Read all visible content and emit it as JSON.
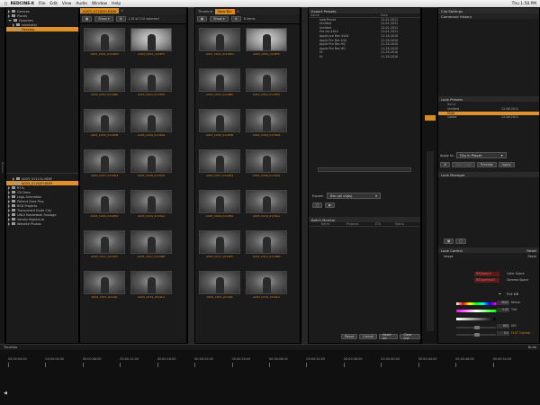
{
  "menubar": {
    "app": "REDCINE-X",
    "items": [
      "File",
      "Edit",
      "View",
      "Audio",
      "Window",
      "Help"
    ],
    "clock": "Thu 1:58 PM"
  },
  "browser": {
    "tree_top": [
      {
        "label": "Devices",
        "selected": false,
        "expanded": false
      },
      {
        "label": "Places",
        "selected": false,
        "expanded": false
      },
      {
        "label": "Favorites",
        "selected": false,
        "expanded": true
      },
      {
        "label": "robohatty",
        "selected": false,
        "expanded": false
      },
      {
        "label": "Desktop",
        "selected": true,
        "expanded": false
      }
    ],
    "tree_bottom": [
      {
        "label": "A003_0111OL.RDM",
        "selected": false
      },
      {
        "label": "A003_0116ZH.RDM",
        "selected": true
      },
      {
        "label": "R??s",
        "selected": false
      },
      {
        "label": "CD Drea",
        "selected": false
      },
      {
        "label": "Lego Animation",
        "selected": false
      },
      {
        "label": "Patient Zero Plus",
        "selected": false
      },
      {
        "label": "RED Projects",
        "selected": false
      },
      {
        "label": "Transcoded Dude City",
        "selected": false
      },
      {
        "label": "UNLV Basketball Footage",
        "selected": false
      },
      {
        "label": "Varsity Nightclub",
        "selected": false
      },
      {
        "label": "Website Photos",
        "selected": false
      }
    ]
  },
  "clips_panel": {
    "tab": "A003_0116ZH.RDM",
    "view_label": "Show",
    "count_text": "110 of 110 selected",
    "clips": [
      "A003_C001_0119W0",
      "A003_C002_0119F6",
      "A003_C003_0119BS",
      "A003_C004_0119HS",
      "A003_C005_0119KM",
      "A003_C006_0119G8",
      "A003_C007_0119R4",
      "A003_C008_0119CD",
      "A003_C009_0119M1",
      "A003_C010_0119AA",
      "A003_C011_0119P3",
      "A003_C012_0119NN",
      "A003_C013_0119JS",
      "A003_C014_0119LU"
    ]
  },
  "bin_panel": {
    "tab_timeline": "Timeline",
    "tab_bin": "New Bin",
    "view_label": "Show",
    "count_text": "8 items",
    "clips": [
      "A003_C001_0119W0",
      "A003_C002_0119F6",
      "A003_C003_0119BS",
      "A003_C004_0119HS",
      "A003_C005_0119KM",
      "A003_C006_0119G8",
      "A003_C007_0119R4",
      "A003_C008_0119CD",
      "A003_C009_0119M1",
      "A003_C010_0119AA",
      "A003_C011_0119P3",
      "A003_C012_0119NN",
      "A003_C013_0119JS",
      "A003_C014_0119LU"
    ]
  },
  "export": {
    "title": "Export Presets",
    "col_name": "Name",
    "col_date": "Date",
    "presets": [
      {
        "name": "InterPreset",
        "date": "12-01-2011"
      },
      {
        "name": "Untitled",
        "date": "12-01-2011"
      },
      {
        "name": "Untitled",
        "date": "12-01-2011"
      },
      {
        "name": "Pro res 4444",
        "date": "12-01-2011"
      },
      {
        "name": "Apple pro Res 4444",
        "date": "11-28-2010"
      },
      {
        "name": "Apple Pro Res 444",
        "date": "11-28-2010"
      },
      {
        "name": "Apple Pro Res HQ",
        "date": "11-28-2010"
      },
      {
        "name": "Apple Pro Res HQ",
        "date": "11-28-2010"
      },
      {
        "name": "Hi",
        "date": "11-28-2010"
      },
      {
        "name": "Hi",
        "date": "11-28-2010"
      }
    ],
    "export_label": "Export:",
    "export_value": "Bin (all clips)",
    "batch_title": "Batch Monitor",
    "batch_cols": [
      "Name",
      "Progress",
      "ETA",
      "Status"
    ],
    "batch_buttons": [
      "Pause",
      "Cancel",
      "Abort All",
      "Clear List"
    ]
  },
  "clip_settings": {
    "title": "Clip Settings",
    "history_title": "Command History"
  },
  "look_presets": {
    "title": "Look Presets",
    "col_name": "Name",
    "items": [
      {
        "name": "Untitled",
        "date": "12-06-2011",
        "selected": false
      },
      {
        "name": "Mute",
        "date": "",
        "selected": true
      },
      {
        "name": "Copier",
        "date": "12-06-2011",
        "selected": false
      }
    ],
    "apply_label": "Apply to:",
    "apply_value": "Clip in Player",
    "preview_label": "Preview",
    "apply_btn": "Apply",
    "save_label": "Save Look"
  },
  "look_manager": {
    "title": "Look Manager"
  },
  "look_control": {
    "title": "Look Control",
    "zoom_label": "Reset",
    "image_label": "Image",
    "image_reset": "Reset",
    "color_space_value": "REDcolor3",
    "color_space_label": "Color Space",
    "gamma_value": "REDgamma3",
    "gamma_label": "Gamma Space",
    "pick_wb": "Pick WB",
    "kelvin_value": "5600",
    "kelvin_label": "Kelvin",
    "tint_value": "0.00",
    "tint_label": "Tint",
    "iso_value": "800",
    "iso_label": "ISO",
    "flut_value": "0.0",
    "flut_label": "FLUT Control"
  },
  "timeline": {
    "title": "Timeline",
    "build_label": "Build",
    "ticks": [
      "00:00:00:00",
      "00:00:04:00",
      "00:00:08:00",
      "00:00:12:00",
      "00:00:16:00",
      "00:00:20:00",
      "00:00:24:00",
      "00:00:28:00",
      "00:00:32:00",
      "00:00:36:00",
      "00:00:40:00",
      "00:00:44:00",
      "00:00:48:00",
      "00:00:52:00"
    ]
  },
  "colors": {
    "accent": "#d98a1c",
    "panel": "#1b1b1b",
    "bg": "#0e0e0e"
  }
}
